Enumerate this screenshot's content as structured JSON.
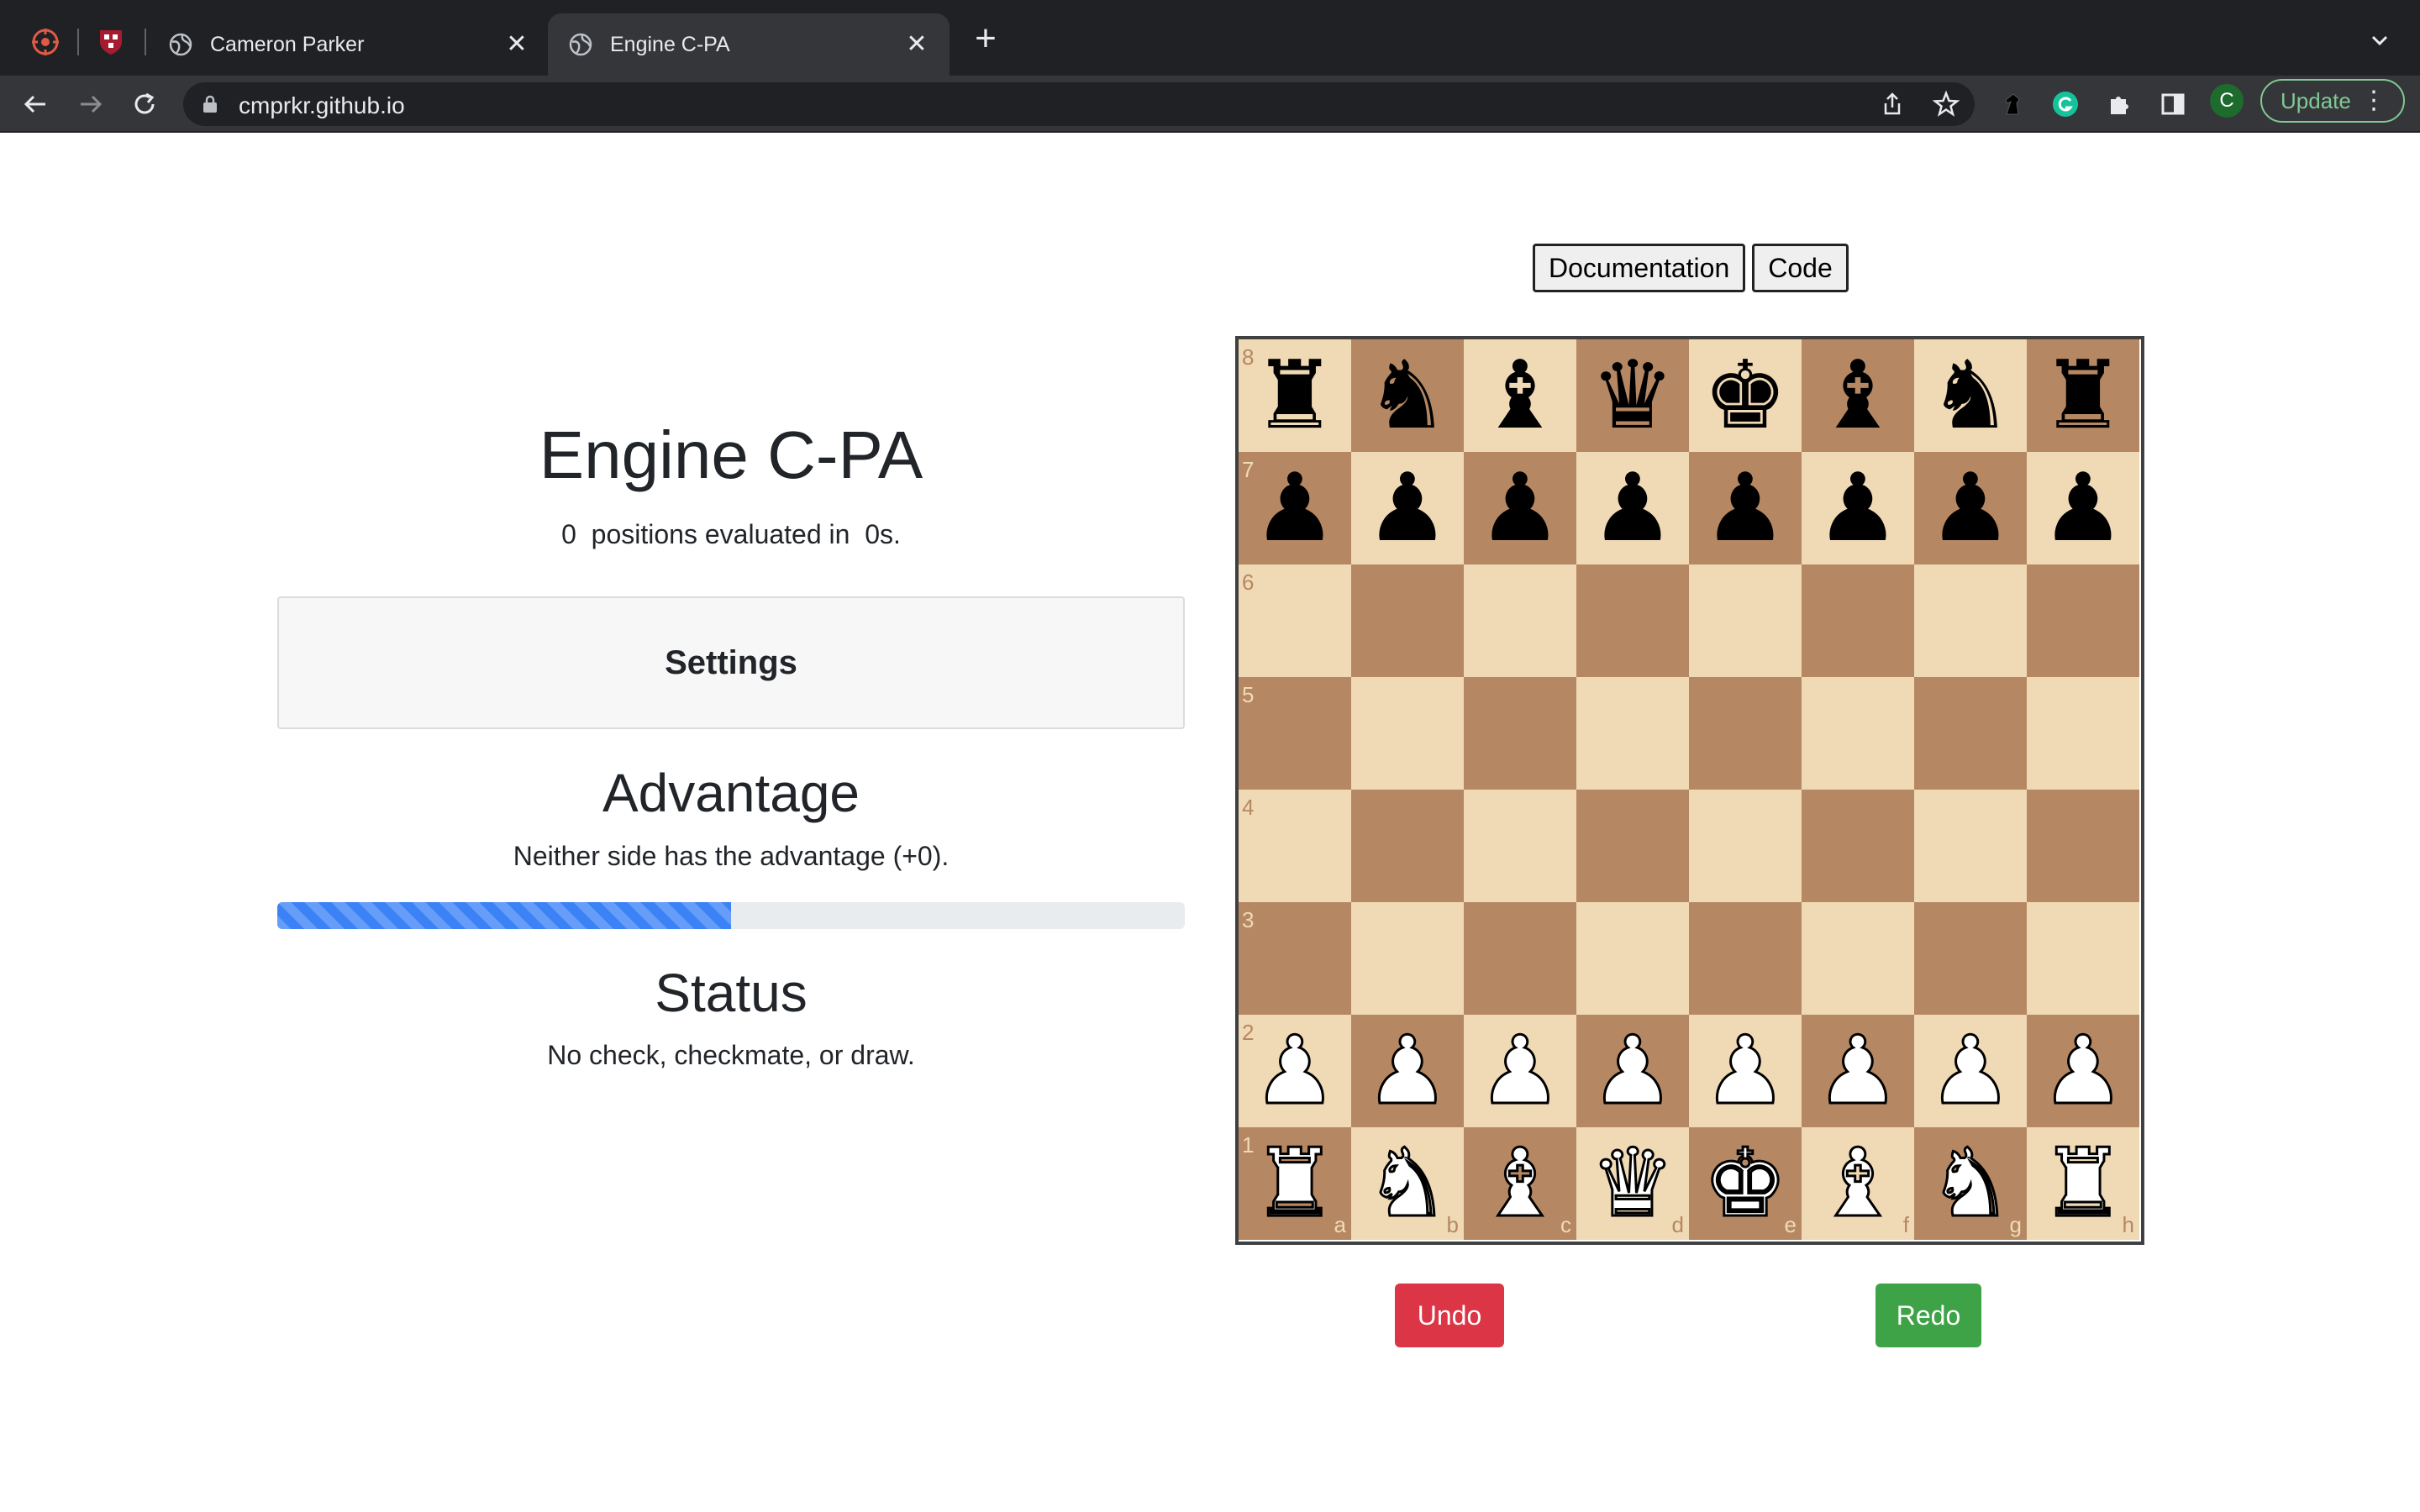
{
  "browser": {
    "tabs": [
      {
        "title": "Cameron Parker",
        "active": false
      },
      {
        "title": "Engine C-PA",
        "active": true
      }
    ],
    "url": "cmprkr.github.io",
    "avatar_letter": "C",
    "update_label": "Update"
  },
  "main": {
    "title": "Engine C-PA",
    "positions_count": "0",
    "positions_mid": "positions evaluated in",
    "time": "0s.",
    "settings_label": "Settings",
    "advantage_heading": "Advantage",
    "advantage_text": "Neither side has the advantage (+0).",
    "advantage_fraction": 0.5,
    "status_heading": "Status",
    "status_text": "No check, checkmate, or draw."
  },
  "buttons": {
    "documentation": "Documentation",
    "code": "Code",
    "undo": "Undo",
    "redo": "Redo"
  },
  "board": {
    "ranks": [
      "r n b q k b n r",
      "p p p p p p p p",
      ". . . . . . . .",
      ". . . . . . . .",
      ". . . . . . . .",
      ". . . . . . . .",
      "P P P P P P P P",
      "R N B Q K B N R"
    ],
    "rank_labels": [
      "8",
      "7",
      "6",
      "5",
      "4",
      "3",
      "2",
      "1"
    ],
    "file_labels": [
      "a",
      "b",
      "c",
      "d",
      "e",
      "f",
      "g",
      "h"
    ]
  },
  "colors": {
    "light_square": "#f0d9b5",
    "dark_square": "#b58863",
    "undo": "#dc3545",
    "redo": "#3ea346",
    "progress": "#3b82f6"
  }
}
